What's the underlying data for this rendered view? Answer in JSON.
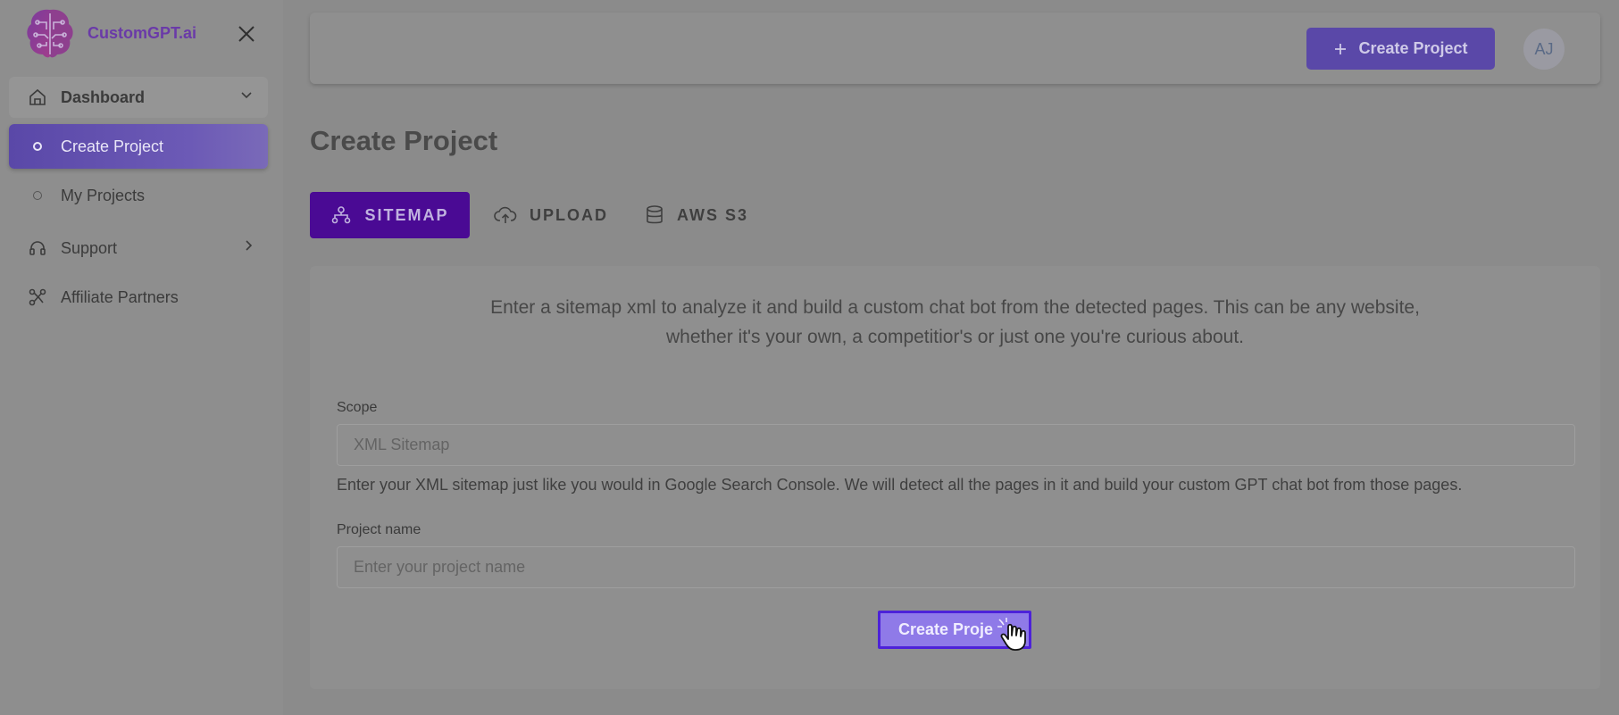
{
  "brand": {
    "name": "CustomGPT.ai",
    "logo_icon": "brain-circuit-icon",
    "accent": "#6a3aa8"
  },
  "sidebar": {
    "close_icon": "close-icon",
    "items": [
      {
        "label": "Dashboard",
        "icon": "home-icon",
        "expand_icon": "chevron-down-icon"
      },
      {
        "label": "Create Project",
        "icon": "circle-dot-icon",
        "active": true
      },
      {
        "label": "My Projects",
        "icon": "circle-dot-icon"
      },
      {
        "label": "Support",
        "icon": "headset-icon",
        "expand_icon": "chevron-right-icon"
      },
      {
        "label": "Affiliate Partners",
        "icon": "network-icon"
      }
    ]
  },
  "header": {
    "create_button_label": "Create Project",
    "create_button_icon": "plus-icon",
    "avatar_initials": "AJ"
  },
  "page": {
    "title": "Create Project"
  },
  "tabs": [
    {
      "label": "SITEMAP",
      "icon": "sitemap-icon",
      "active": true
    },
    {
      "label": "UPLOAD",
      "icon": "cloud-upload-icon"
    },
    {
      "label": "AWS S3",
      "icon": "database-icon"
    }
  ],
  "form": {
    "intro_line1": "Enter a sitemap xml to analyze it and build a custom chat bot from the detected pages. This can be any website,",
    "intro_line2": "whether it's your own, a competitior's or just one you're curious about.",
    "scope_label": "Scope",
    "scope_placeholder": "XML Sitemap",
    "scope_value": "",
    "scope_help": "Enter your XML sitemap just like you would in Google Search Console. We will detect all the pages in it and build your custom GPT chat bot from those pages.",
    "name_label": "Project name",
    "name_placeholder": "Enter your project name",
    "name_value": "",
    "submit_label": "Create Proje",
    "cursor_icon": "hand-pointer-icon"
  },
  "colors": {
    "primary": "#5a48a8",
    "tab_active": "#4a0a94",
    "submit_bg": "#8f7ae8",
    "submit_border": "#4d22d9"
  }
}
